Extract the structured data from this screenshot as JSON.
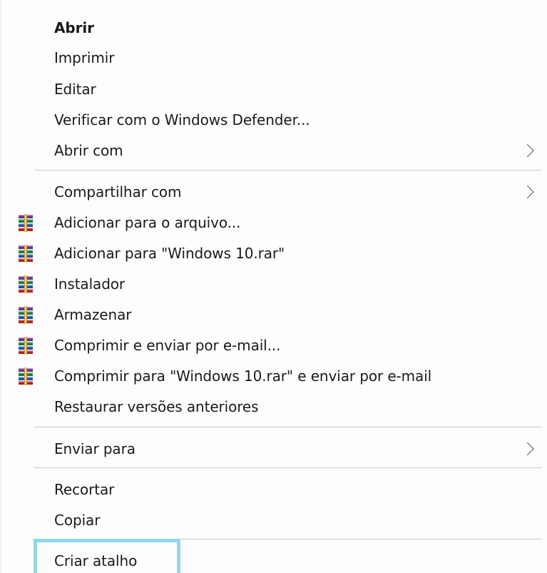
{
  "menu": {
    "items": [
      {
        "label": "Abrir",
        "bold": true
      },
      {
        "label": "Imprimir"
      },
      {
        "label": "Editar"
      },
      {
        "label": "Verificar com o Windows Defender..."
      },
      {
        "label": "Abrir com",
        "submenu": true
      },
      {
        "label": "Compartilhar com",
        "submenu": true
      },
      {
        "label": "Adicionar para o arquivo...",
        "icon": "winrar-icon"
      },
      {
        "label": "Adicionar para \"Windows 10.rar\"",
        "icon": "winrar-icon"
      },
      {
        "label": "Instalador",
        "icon": "winrar-icon"
      },
      {
        "label": "Armazenar",
        "icon": "winrar-icon"
      },
      {
        "label": "Comprimir e enviar por e-mail...",
        "icon": "winrar-icon"
      },
      {
        "label": "Comprimir para \"Windows 10.rar\" e enviar por e-mail",
        "icon": "winrar-icon"
      },
      {
        "label": "Restaurar versões anteriores"
      },
      {
        "label": "Enviar para",
        "submenu": true
      },
      {
        "label": "Recortar"
      },
      {
        "label": "Copiar"
      },
      {
        "label": "Criar atalho",
        "highlighted": true
      }
    ]
  },
  "colors": {
    "highlight_border": "#8fd7ea",
    "separator": "#c8c8c8"
  }
}
